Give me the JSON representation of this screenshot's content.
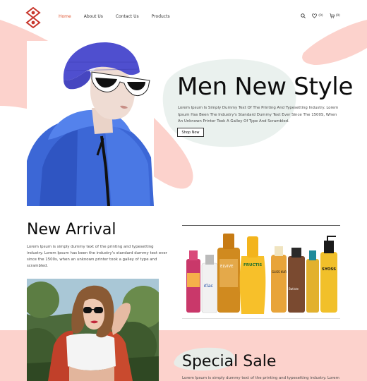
{
  "nav": {
    "items": [
      {
        "label": "Home",
        "active": true
      },
      {
        "label": "About Us",
        "active": false
      },
      {
        "label": "Contact Us",
        "active": false
      },
      {
        "label": "Products",
        "active": false
      }
    ],
    "wishlist_count": "(0)",
    "cart_count": "(0)"
  },
  "hero": {
    "title": "Men New Style",
    "text": "Lorem Ipsum Is Simply Dummy Text Of The Printing And Typesetting Industry. Lorem Ipsum Has Been The Industry's Standard Dummy Text Ever Since The 1500S, When An Unknown Printer Took A Galley Of Type And Scrambled.",
    "button_label": "Shop Now"
  },
  "arrival": {
    "title": "New Arrival",
    "text": "Lorem Ipsum is simply dummy text of the printing and typesetting industry. Lorem Ipsum has been the industry's standard dummy text ever since the 1500s, when an unknown printer took a galley of type and scrambled."
  },
  "products": {
    "labels": [
      "ELVIVE",
      "FRUCTIS",
      "GLISS KUR",
      "Klas",
      "SYOSS",
      "Batiste"
    ]
  },
  "sale": {
    "title": "Special Sale",
    "text": "Lorem Ipsum is simply dummy text of the printing and typesetting industry. Lorem"
  },
  "colors": {
    "accent": "#e0532f",
    "blush": "#fcd2cc",
    "mint": "#e6eeeb"
  }
}
